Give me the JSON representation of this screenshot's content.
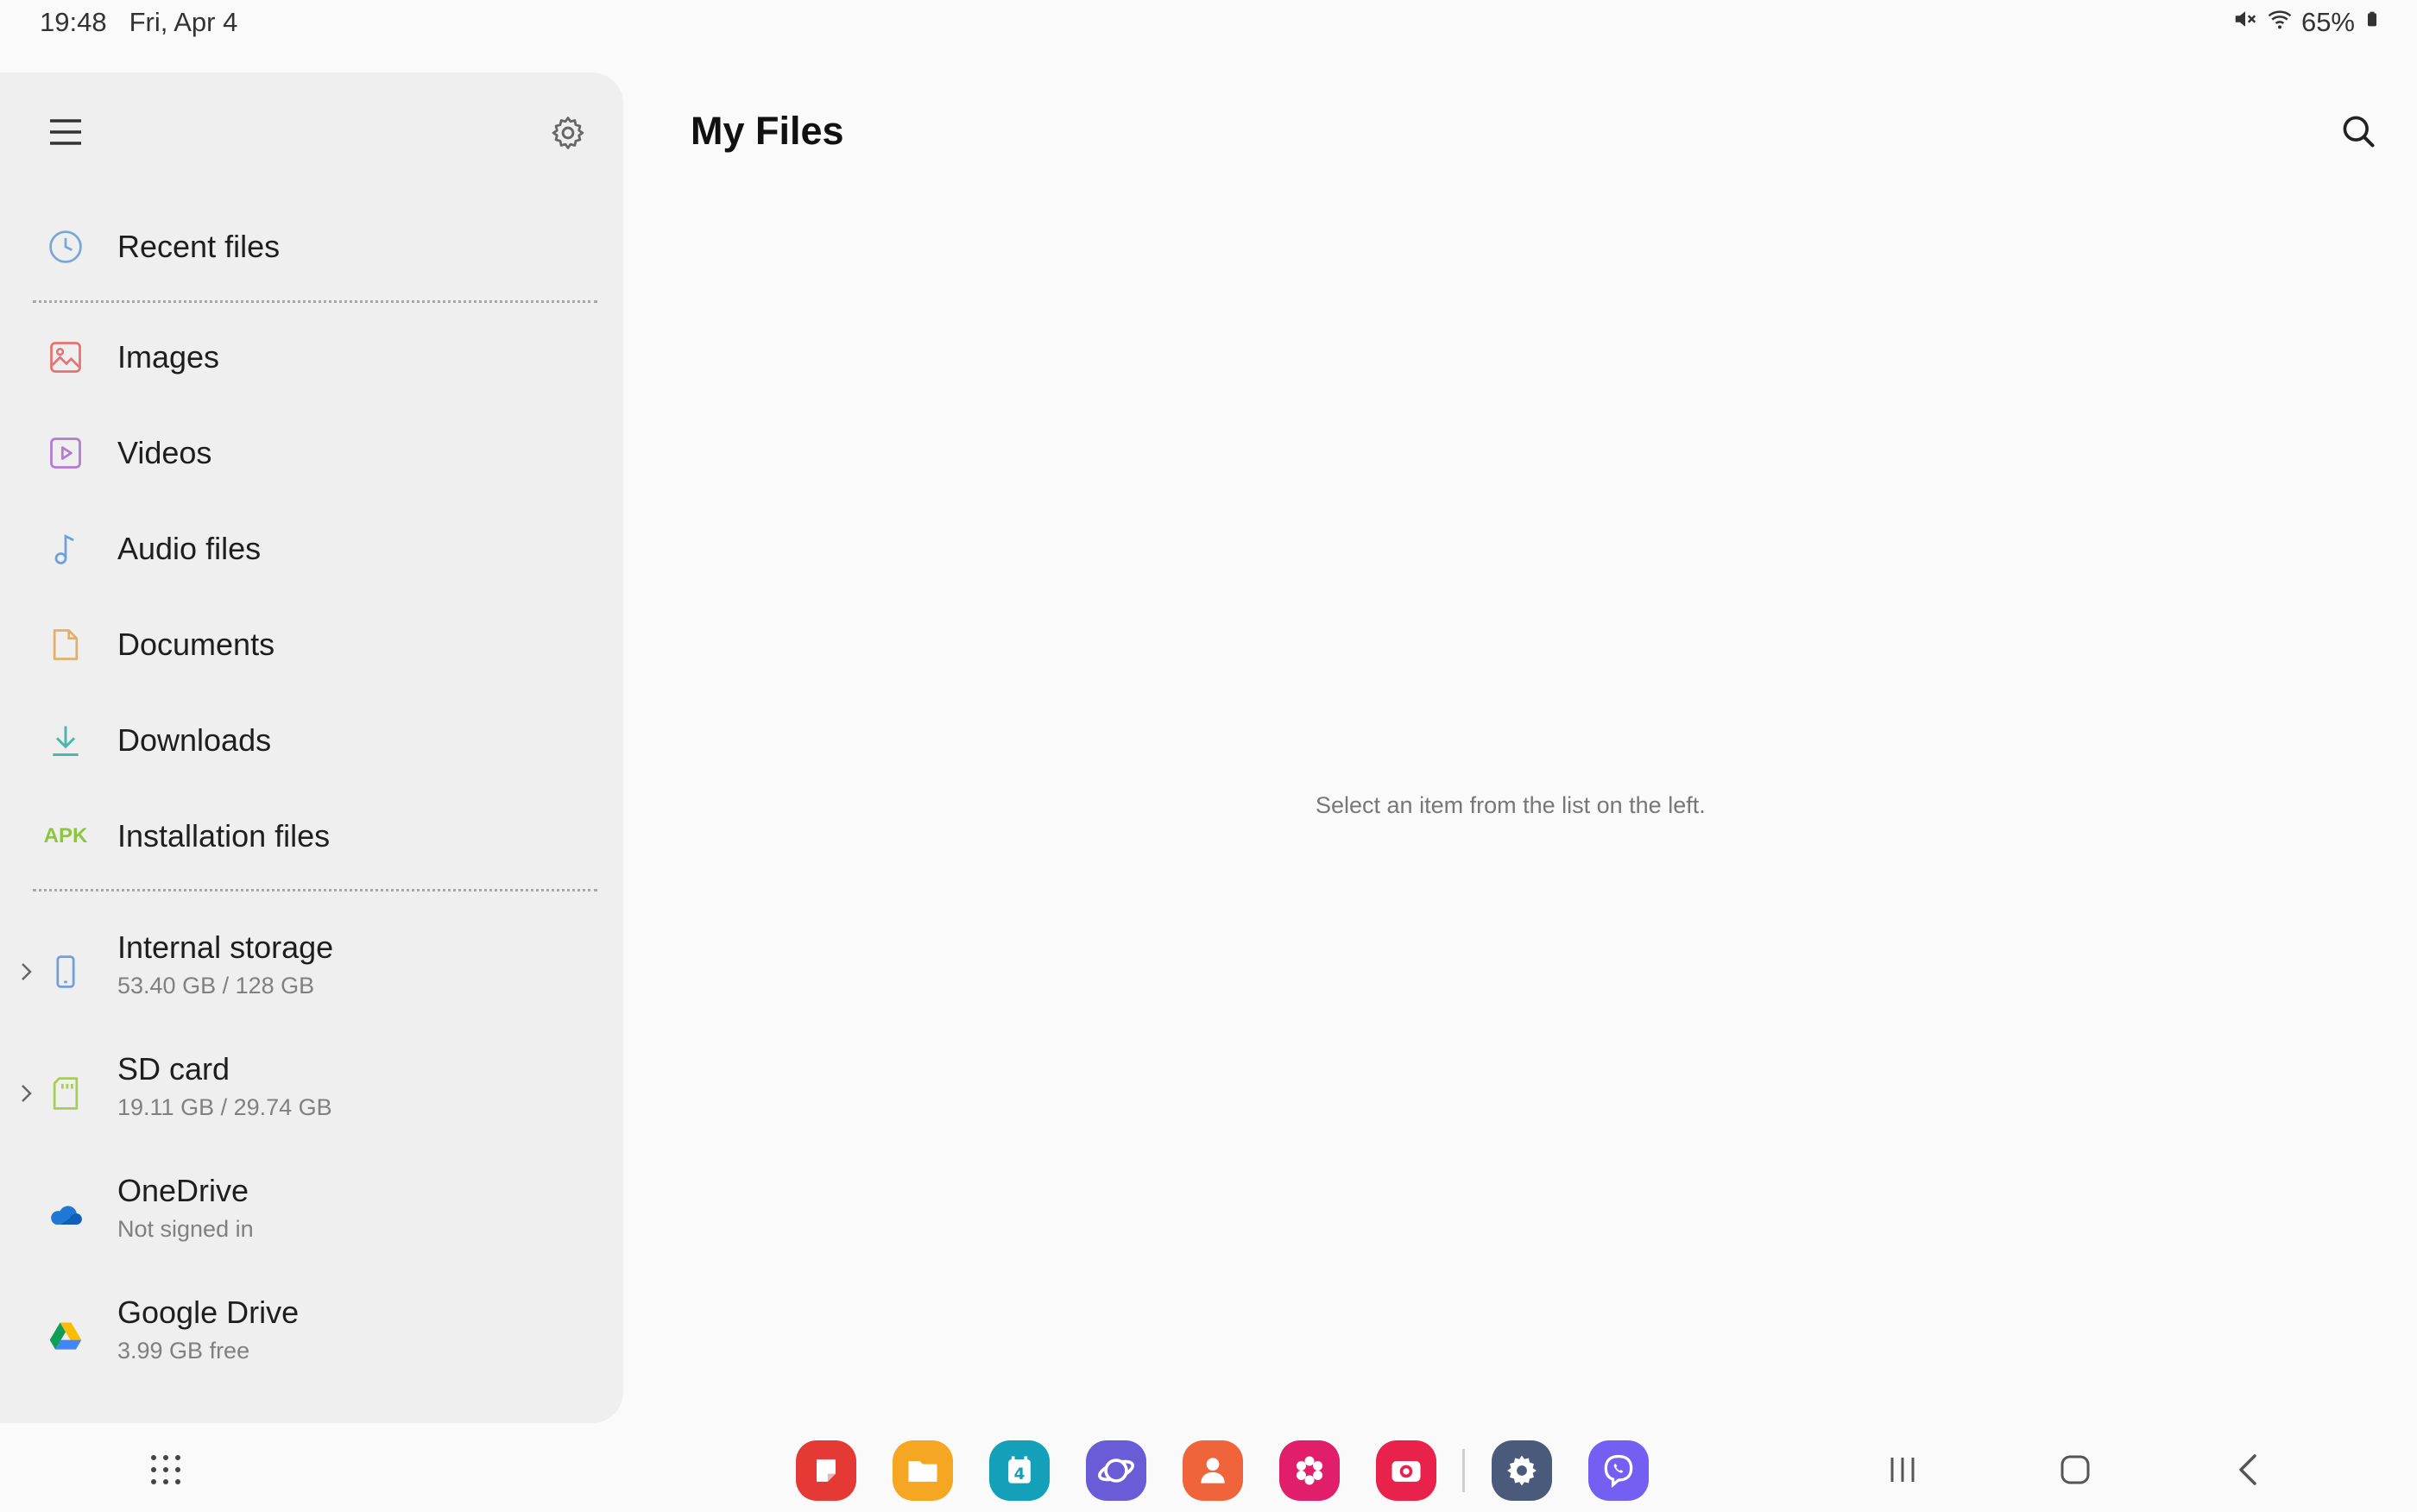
{
  "status_bar": {
    "time": "19:48",
    "date": "Fri, Apr 4",
    "battery": "65%",
    "icons": [
      "mute-icon",
      "wifi-icon",
      "battery-icon"
    ]
  },
  "sidebar": {
    "menu_icon": "hamburger-icon",
    "settings_icon": "gear-icon",
    "recent": {
      "label": "Recent files",
      "icon": "clock-icon"
    },
    "categories": [
      {
        "label": "Images",
        "icon": "image-icon"
      },
      {
        "label": "Videos",
        "icon": "video-icon"
      },
      {
        "label": "Audio files",
        "icon": "music-note-icon"
      },
      {
        "label": "Documents",
        "icon": "document-icon"
      },
      {
        "label": "Downloads",
        "icon": "download-icon"
      },
      {
        "label": "Installation files",
        "icon_text": "APK"
      }
    ],
    "storage": [
      {
        "label": "Internal storage",
        "sub": "53.40 GB / 128 GB",
        "icon": "phone-icon"
      },
      {
        "label": "SD card",
        "sub": "19.11 GB / 29.74 GB",
        "icon": "sd-card-icon"
      },
      {
        "label": "OneDrive",
        "sub": "Not signed in",
        "icon": "onedrive-icon"
      },
      {
        "label": "Google Drive",
        "sub": "3.99 GB free",
        "icon": "google-drive-icon"
      }
    ]
  },
  "main": {
    "title": "My Files",
    "empty_message": "Select an item from the list on the left."
  },
  "taskbar": {
    "apps": [
      {
        "name": "samsung-notes",
        "color": "#e53935"
      },
      {
        "name": "my-files",
        "color": "#f5a623"
      },
      {
        "name": "calendar",
        "color": "#13a0b8",
        "text": "4"
      },
      {
        "name": "samsung-internet",
        "color": "#6a5bd6"
      },
      {
        "name": "contacts",
        "color": "#f0643c"
      },
      {
        "name": "gallery",
        "color": "#e01e6a"
      },
      {
        "name": "camera",
        "color": "#e8224a"
      },
      {
        "name": "settings",
        "color": "#4a5a7a"
      },
      {
        "name": "viber",
        "color": "#7360f2"
      }
    ]
  }
}
